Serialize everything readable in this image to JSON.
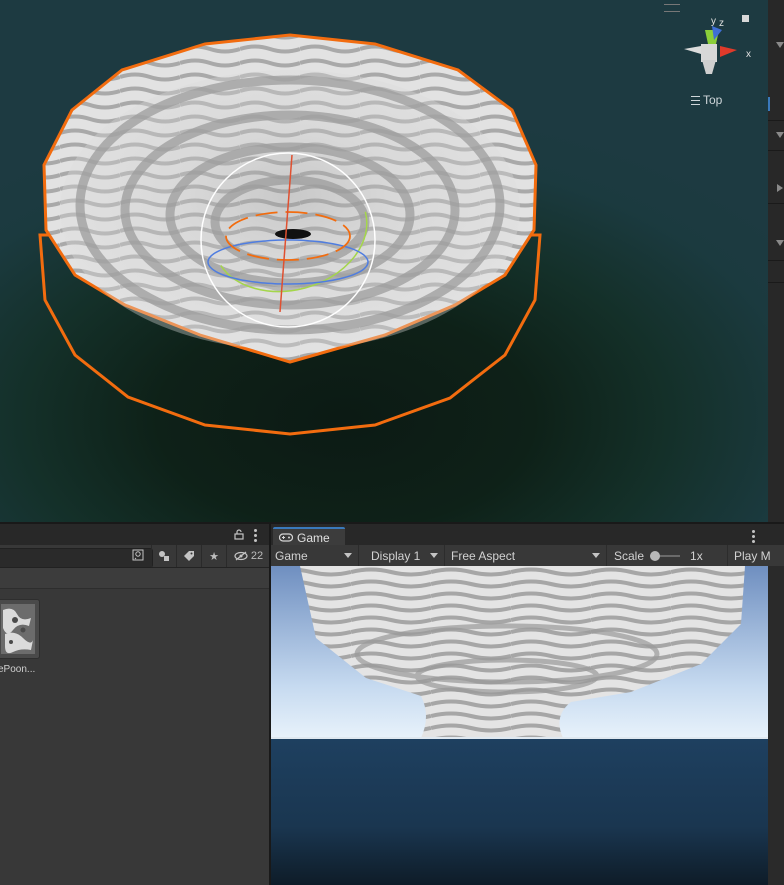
{
  "scene": {
    "view_label": "Top",
    "gizmo_axes": {
      "y": "y",
      "z": "z",
      "x": "x"
    },
    "icons": [
      "axis-gizmo-icon",
      "close-icon"
    ]
  },
  "project": {
    "search": {
      "value": "",
      "placeholder": ""
    },
    "hidden_count": "22",
    "asset": {
      "label": "ePoon..."
    },
    "icons": [
      "lock-icon",
      "kebab-menu-icon",
      "search-options-icon",
      "filter-type-icon",
      "label-icon",
      "favorite-star-icon",
      "hidden-eye-icon"
    ]
  },
  "game": {
    "tab_label": "Game",
    "dropdowns": {
      "mode": "Game",
      "display": "Display 1",
      "aspect": "Free Aspect"
    },
    "scale_label": "Scale",
    "scale_value": "1x",
    "play_label": "Play M",
    "icons": [
      "gamepad-icon",
      "kebab-menu-icon"
    ]
  },
  "colors": {
    "selection_outline": "#f26c0f",
    "accent_tab": "#3a79bb",
    "sky_top": "#6f8fc0",
    "sea": "#1b3a52"
  }
}
